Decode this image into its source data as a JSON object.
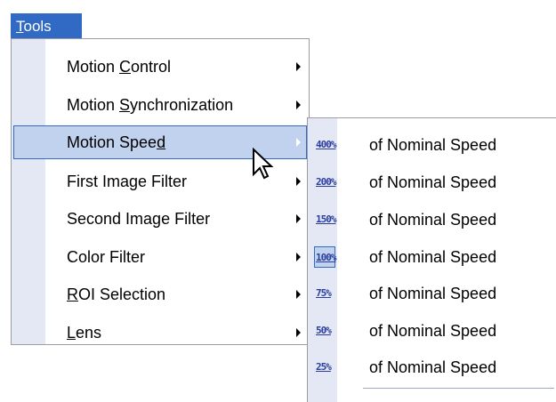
{
  "menubar": {
    "tools_label_u": "T",
    "tools_label_rest": "ools"
  },
  "menu": {
    "items": [
      {
        "pre": "Motion ",
        "u": "C",
        "post": "ontrol"
      },
      {
        "pre": "Motion ",
        "u": "S",
        "post": "ynchronization"
      },
      {
        "pre": "Motion Spee",
        "u": "d",
        "post": ""
      },
      {
        "pre": "First Image Filter",
        "u": "",
        "post": ""
      },
      {
        "pre": "Second Image Filter",
        "u": "",
        "post": ""
      },
      {
        "pre": "Color Filter",
        "u": "",
        "post": ""
      },
      {
        "pre": "",
        "u": "R",
        "post": "OI Selection"
      },
      {
        "pre": "",
        "u": "L",
        "post": "ens"
      }
    ]
  },
  "submenu": {
    "items": [
      {
        "icon": "400%",
        "label": "of Nominal Speed"
      },
      {
        "icon": "200%",
        "label": "of Nominal Speed"
      },
      {
        "icon": "150%",
        "label": "of Nominal Speed"
      },
      {
        "icon": "100%",
        "label": "of Nominal Speed",
        "checked": true
      },
      {
        "icon": "75%",
        "label": "of Nominal Speed"
      },
      {
        "icon": "50%",
        "label": "of Nominal Speed"
      },
      {
        "icon": "25%",
        "label": "of Nominal Speed"
      }
    ]
  },
  "colors": {
    "highlight": "#316ac5",
    "highlight_fill": "#c1d2ee",
    "gutter": "#e3e8f4",
    "icon_blue": "#2a3d9e"
  }
}
